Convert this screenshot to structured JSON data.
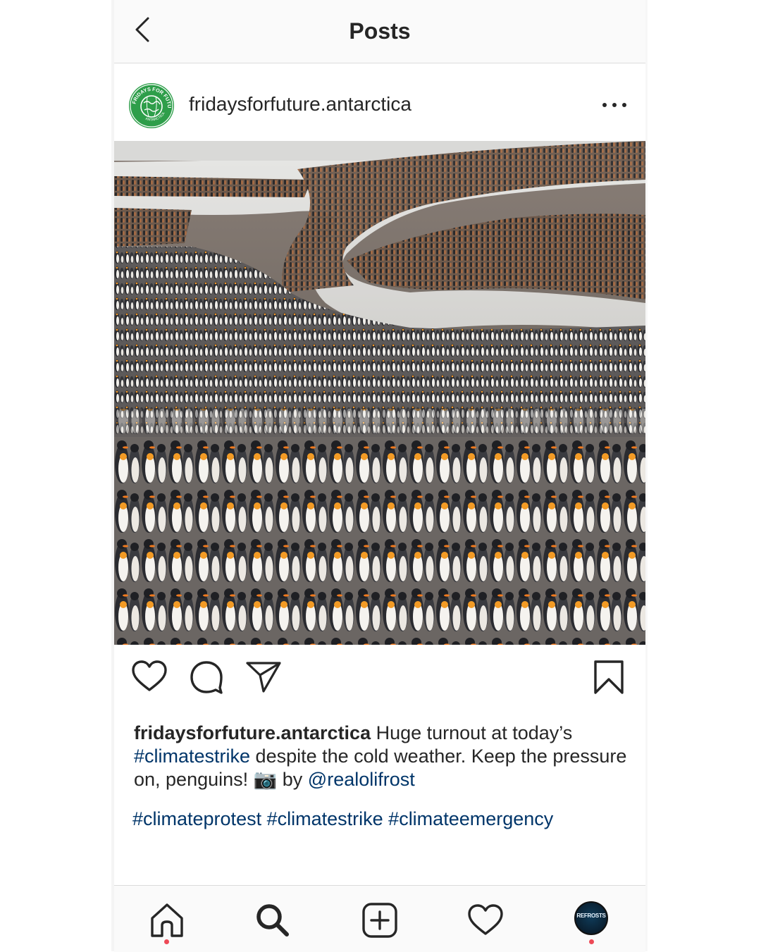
{
  "header": {
    "title": "Posts"
  },
  "post": {
    "username": "fridaysforfuture.antarctica",
    "avatar_text": "FRIDAYS FOR FUTURE · ANTARCTICA",
    "caption": {
      "user": "fridaysforfuture.antarctica",
      "text_1": " Huge turnout at today’s ",
      "tag_1": "#climatestrike",
      "text_2": " despite the cold weather. Keep the pressure on, penguins! ",
      "camera_emoji": "📷",
      "text_3": " by ",
      "mention": "@realolifrost"
    },
    "hashtags": [
      "#climateprotest",
      "#climatestrike",
      "#climateemergency"
    ]
  },
  "tabbar": {
    "profile_avatar_text": "REFROSTS"
  },
  "colors": {
    "link": "#003569",
    "text": "#262626",
    "divider": "#dbdbdb",
    "notification_dot": "#ed4956",
    "avatar_green": "#2e9e4a"
  }
}
